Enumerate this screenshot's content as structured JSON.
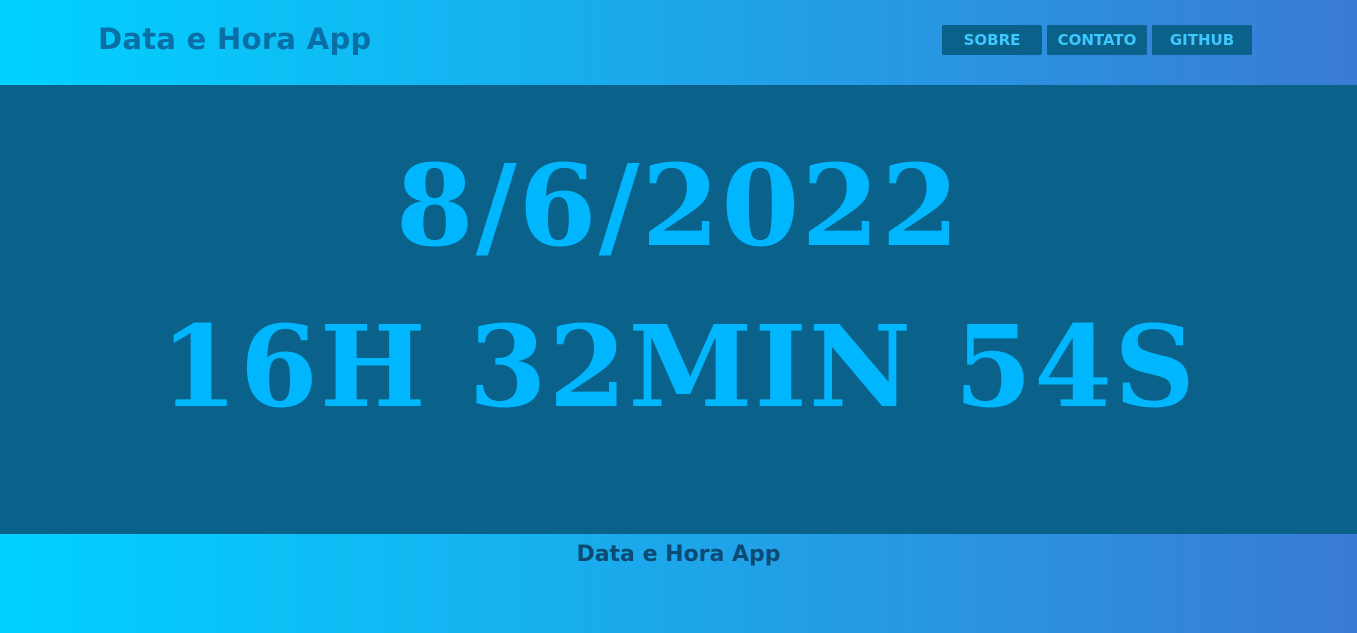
{
  "header": {
    "title": "Data e Hora App",
    "nav": [
      {
        "label": "SOBRE"
      },
      {
        "label": "CONTATO"
      },
      {
        "label": "GITHUB"
      }
    ]
  },
  "clock": {
    "date": "8/6/2022",
    "time": "16H 32MIN 54S"
  },
  "footer": {
    "text": "Data e Hora App"
  },
  "colors": {
    "gradient_start": "#00d2ff",
    "gradient_end": "#3a7bd5",
    "main_background": "#0a6189",
    "clock_text": "#00b7ff",
    "nav_button_background": "#0a6189",
    "nav_button_text": "#3fc8ff"
  }
}
